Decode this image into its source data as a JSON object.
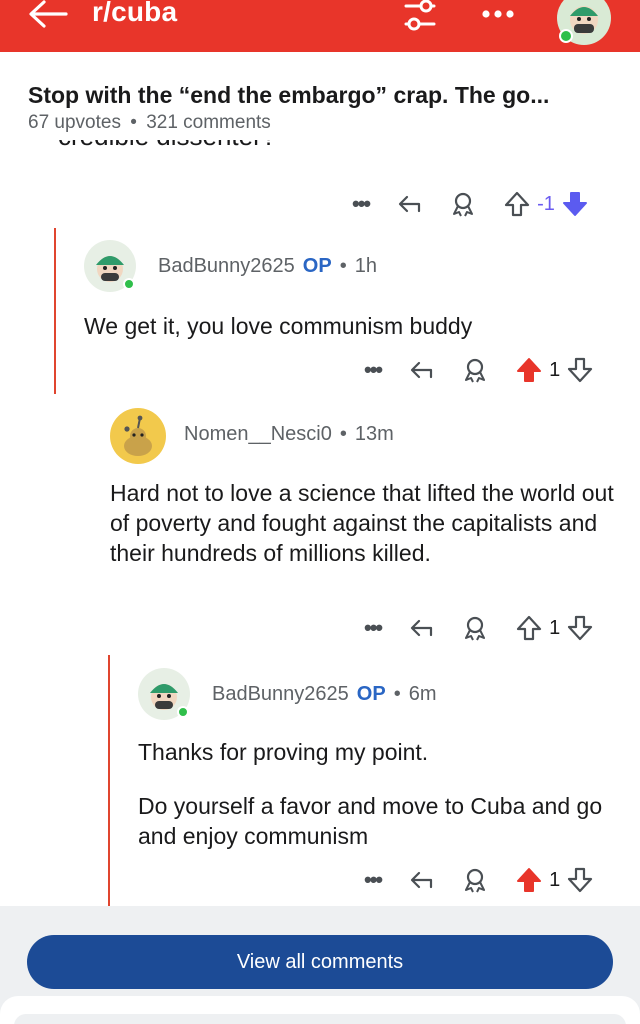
{
  "header": {
    "subreddit": "r/cuba",
    "icons": [
      "back-arrow-icon",
      "filter-icon",
      "more-icon",
      "user-avatar-icon"
    ],
    "bar_color": "#e8352a"
  },
  "post": {
    "title": "Stop with the “end the embargo” crap. The go...",
    "upvotes": "67 upvotes",
    "separator": "•",
    "comments": "321 comments"
  },
  "cutoff_text": "credible dissenter?",
  "parent_actions": {
    "more": "•••",
    "vote": "-1",
    "voted": "down"
  },
  "comments": [
    {
      "username": "BadBunny2625",
      "op": "OP",
      "dot": "•",
      "age": "1h",
      "body": [
        "We get it, you love communism buddy"
      ],
      "more": "•••",
      "votes": "1",
      "voted": "up"
    },
    {
      "username": "Nomen__Nesci0",
      "op": "",
      "dot": "•",
      "age": "13m",
      "body": [
        "Hard not to love a science that lifted the world out of poverty and fought against the capitalists and their hundreds of millions killed."
      ],
      "more": "•••",
      "votes": "1",
      "voted": "none"
    },
    {
      "username": "BadBunny2625",
      "op": "OP",
      "dot": "•",
      "age": "6m",
      "body": [
        "Thanks for proving my point.",
        "Do yourself a favor and move to Cuba and go and enjoy communism"
      ],
      "more": "•••",
      "votes": "1",
      "voted": "up"
    }
  ],
  "footer": {
    "view_all": "View all comments"
  },
  "colors": {
    "accent": "#e8352a",
    "upvote": "#e8352a",
    "downvote": "#5b5bf0",
    "button": "#1c4b96",
    "op": "#2a66c4",
    "online": "#2fbf4a"
  }
}
